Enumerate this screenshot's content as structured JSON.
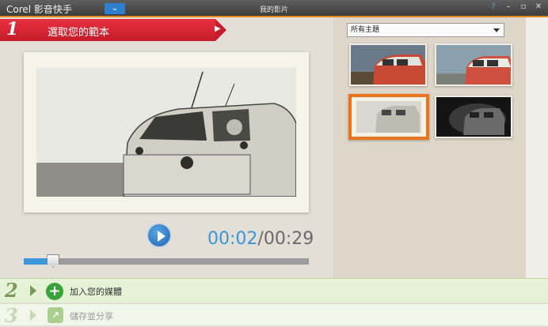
{
  "window": {
    "app_title": "Corel 影音快手",
    "title": "我的影片",
    "menu_glyph": "⌄",
    "controls": [
      "?",
      "–",
      "▫",
      "✕"
    ]
  },
  "step1": {
    "number": "1",
    "label": "選取您的範本"
  },
  "player": {
    "current_time": "00:02",
    "separator": "/",
    "total_time": "00:29",
    "progress": 0.07
  },
  "themes": {
    "dropdown_value": "所有主題",
    "thumbnails": [
      {
        "name": "vintage-color-a",
        "selected": false
      },
      {
        "name": "vintage-color-b",
        "selected": false
      },
      {
        "name": "sepia-frame",
        "selected": true
      },
      {
        "name": "dark-vignette",
        "selected": false
      }
    ]
  },
  "step2": {
    "number": "2",
    "label": "加入您的媒體"
  },
  "step3": {
    "number": "3",
    "label": "儲存並分享"
  },
  "colors": {
    "accent_red": "#d4202f",
    "accent_orange": "#e8741b",
    "accent_blue": "#3896d8",
    "step_green": "#3aa23a"
  }
}
